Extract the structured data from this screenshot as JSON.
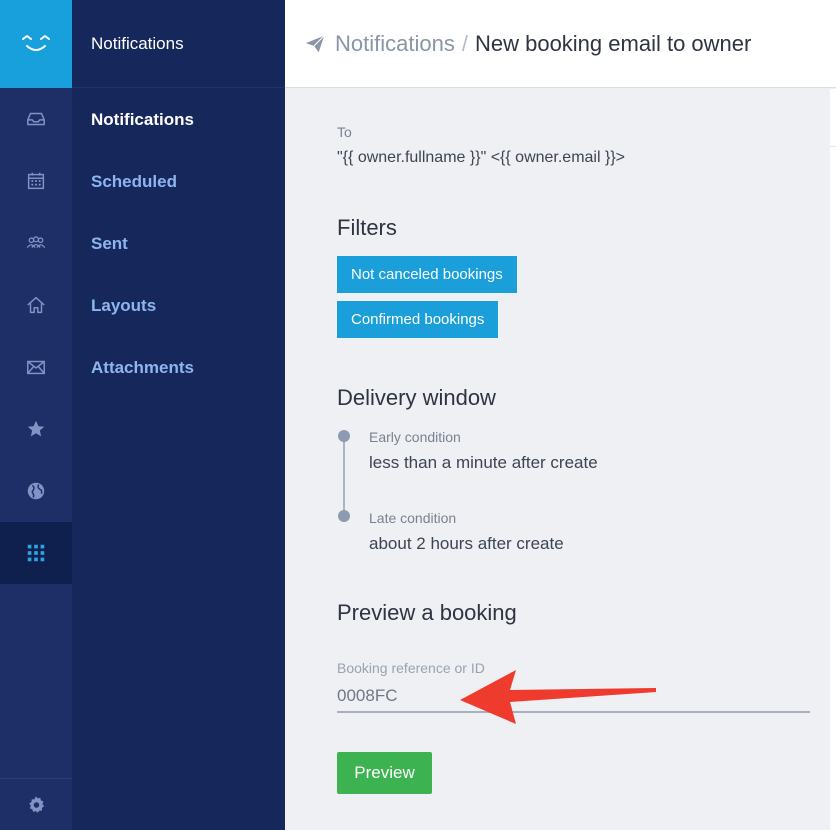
{
  "sidebar": {
    "icons": [
      "inbox-icon",
      "calendar-icon",
      "people-icon",
      "home-icon",
      "envelope-icon",
      "star-icon",
      "globe-icon",
      "grid-icon",
      "gear-icon"
    ],
    "active_icon": "grid-icon"
  },
  "subnav": {
    "header": "Notifications",
    "items": [
      {
        "label": "Notifications",
        "active": true
      },
      {
        "label": "Scheduled",
        "active": false
      },
      {
        "label": "Sent",
        "active": false
      },
      {
        "label": "Layouts",
        "active": false
      },
      {
        "label": "Attachments",
        "active": false
      }
    ]
  },
  "breadcrumb": {
    "icon": "paper-plane-icon",
    "parent": "Notifications",
    "separator": "/",
    "current": "New booking email to owner"
  },
  "recipient": {
    "label": "To",
    "value": "\"{{ owner.fullname }}\" <{{ owner.email }}>"
  },
  "filters": {
    "heading": "Filters",
    "items": [
      "Not canceled bookings",
      "Confirmed bookings"
    ]
  },
  "delivery": {
    "heading": "Delivery window",
    "early": {
      "label": "Early condition",
      "value": "less than a minute after create"
    },
    "late": {
      "label": "Late condition",
      "value": "about 2 hours after create"
    }
  },
  "preview": {
    "heading": "Preview a booking",
    "input_label": "Booking reference or ID",
    "input_value": "0008FC",
    "button": "Preview"
  },
  "colors": {
    "brand": "#17a0db",
    "rail": "#1e2f67",
    "subnav": "#16275c",
    "filter_button": "#1a9fda",
    "preview_button": "#3cb251",
    "annotation_arrow": "#ef3b2d"
  }
}
